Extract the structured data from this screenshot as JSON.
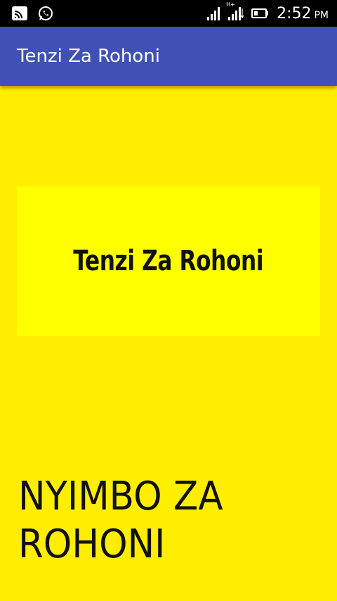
{
  "status_bar": {
    "time": "2:52",
    "ampm": "PM",
    "network_label": "H+",
    "icons": [
      "cast-icon",
      "whatsapp-icon",
      "signal-icon",
      "signal-icon",
      "battery-icon"
    ]
  },
  "app_bar": {
    "title": "Tenzi Za Rohoni",
    "color": "#3f51b5"
  },
  "main": {
    "logo_text": "Tenzi Za Rohoni",
    "heading": "NYIMBO ZA ROHONI",
    "background": "#ffee00",
    "banner_color": "#ffff00"
  }
}
